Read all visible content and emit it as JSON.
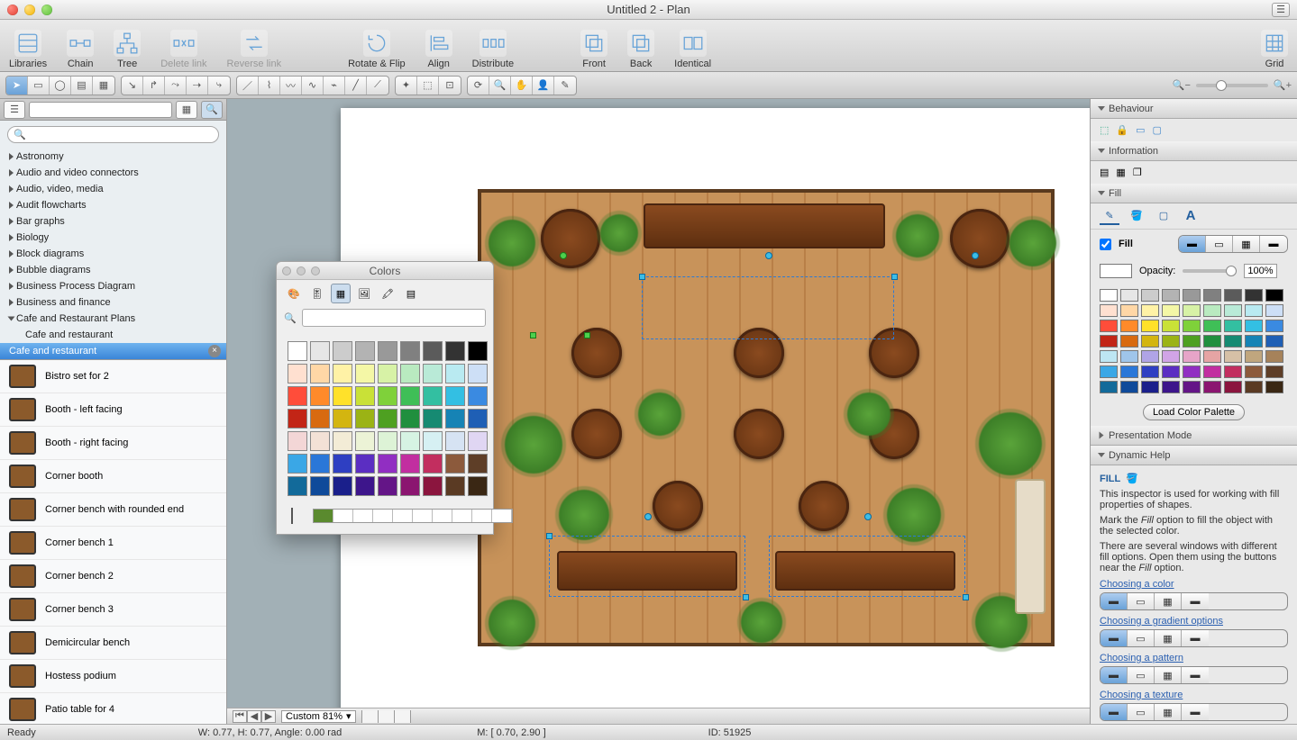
{
  "window": {
    "title": "Untitled 2 - Plan"
  },
  "toolbar": [
    {
      "id": "libraries",
      "label": "Libraries"
    },
    {
      "id": "chain",
      "label": "Chain"
    },
    {
      "id": "tree",
      "label": "Tree"
    },
    {
      "id": "delete-link",
      "label": "Delete link"
    },
    {
      "id": "reverse-link",
      "label": "Reverse link"
    },
    {
      "id": "rotate-flip",
      "label": "Rotate & Flip"
    },
    {
      "id": "align",
      "label": "Align"
    },
    {
      "id": "distribute",
      "label": "Distribute"
    },
    {
      "id": "front",
      "label": "Front"
    },
    {
      "id": "back",
      "label": "Back"
    },
    {
      "id": "identical",
      "label": "Identical"
    },
    {
      "id": "grid",
      "label": "Grid"
    }
  ],
  "sidebar": {
    "search_placeholder": "",
    "categories": [
      "Astronomy",
      "Audio and video connectors",
      "Audio, video, media",
      "Audit flowcharts",
      "Bar graphs",
      "Biology",
      "Block diagrams",
      "Bubble diagrams",
      "Business Process Diagram",
      "Business and finance",
      "Cafe and Restaurant Plans"
    ],
    "open_child": "Cafe and restaurant",
    "selected": "Cafe and restaurant",
    "shapes": [
      "Bistro set for 2",
      "Booth - left facing",
      "Booth - right facing",
      "Corner booth",
      "Corner bench with rounded end",
      "Corner bench 1",
      "Corner bench 2",
      "Corner bench 3",
      "Demicircular bench",
      "Hostess podium",
      "Patio table for 4"
    ]
  },
  "colors_popup": {
    "title": "Colors",
    "grid": [
      "#ffffff",
      "#e6e6e6",
      "#cccccc",
      "#b3b3b3",
      "#999999",
      "#808080",
      "#5b5b5b",
      "#333333",
      "#000000",
      "#ffe0d0",
      "#ffd7a6",
      "#fff2a6",
      "#f4f7a6",
      "#d7f2a6",
      "#b9eac0",
      "#b9ead7",
      "#b9eaf1",
      "#cddff6",
      "#ff4d3a",
      "#ff8a2a",
      "#ffe12a",
      "#c9e137",
      "#7fd13a",
      "#3fbf57",
      "#33bfa1",
      "#33bfe3",
      "#3a8ae1",
      "#c22516",
      "#d86a10",
      "#d3b510",
      "#9bb315",
      "#4ea021",
      "#208f3e",
      "#168a72",
      "#1683b5",
      "#1f5fb5",
      "#f3d6d6",
      "#f3e1d6",
      "#f3ecd6",
      "#ecf3d6",
      "#ddf3d6",
      "#d6f3e3",
      "#d6f0f3",
      "#d6e3f3",
      "#e0d6f3",
      "#3aa7e6",
      "#2a77d8",
      "#2e3fc2",
      "#5b2ec2",
      "#912ec2",
      "#c22ea0",
      "#c22e5f",
      "#8c5a3c",
      "#5e3e27",
      "#126a9a",
      "#0f4a9a",
      "#1a1f8b",
      "#3d158b",
      "#641587",
      "#8b1570",
      "#8b153e",
      "#5a3a23",
      "#3a2714"
    ],
    "recent": [
      "#5a8a2e",
      "#ffffff",
      "#ffffff",
      "#ffffff",
      "#ffffff",
      "#ffffff",
      "#ffffff",
      "#ffffff",
      "#ffffff",
      "#ffffff"
    ]
  },
  "inspector": {
    "sections": [
      "Behaviour",
      "Information",
      "Fill",
      "Presentation Mode",
      "Dynamic Help"
    ],
    "fill": {
      "checkbox_label": "Fill",
      "opacity_label": "Opacity:",
      "opacity_value": "100%",
      "load_btn": "Load Color Palette",
      "palette": [
        "#ffffff",
        "#e6e6e6",
        "#cccccc",
        "#b3b3b3",
        "#999999",
        "#808080",
        "#5b5b5b",
        "#333333",
        "#000000",
        "#ffe0d0",
        "#ffd7a6",
        "#fff2a6",
        "#f4f7a6",
        "#d7f2a6",
        "#b9eac0",
        "#b9ead7",
        "#b9eaf1",
        "#cddff6",
        "#ff4d3a",
        "#ff8a2a",
        "#ffe12a",
        "#c9e137",
        "#7fd13a",
        "#3fbf57",
        "#33bfa1",
        "#33bfe3",
        "#3a8ae1",
        "#c22516",
        "#d86a10",
        "#d3b510",
        "#9bb315",
        "#4ea021",
        "#208f3e",
        "#168a72",
        "#1683b5",
        "#1f5fb5",
        "#bde6f3",
        "#9fc5ea",
        "#b0a4e6",
        "#d1a4e6",
        "#e6a4c8",
        "#e6a4a4",
        "#d6c0a6",
        "#c0a67e",
        "#a6825a",
        "#3aa7e6",
        "#2a77d8",
        "#2e3fc2",
        "#5b2ec2",
        "#912ec2",
        "#c22ea0",
        "#c22e5f",
        "#8c5a3c",
        "#5e3e27",
        "#126a9a",
        "#0f4a9a",
        "#1a1f8b",
        "#3d158b",
        "#641587",
        "#8b1570",
        "#8b153e",
        "#5a3a23",
        "#3a2714"
      ]
    },
    "help": {
      "title": "FILL",
      "p1": "This inspector is used for working with fill properties of shapes.",
      "p2a": "Mark the ",
      "p2i": "Fill",
      "p2b": " option to fill the object with the selected color.",
      "p3a": "There are several windows with different fill options. Open them using the buttons near the ",
      "p3i": "Fill",
      "p3b": " option.",
      "links": [
        "Choosing a color",
        "Choosing a gradient options",
        "Choosing a pattern",
        "Choosing a texture"
      ]
    }
  },
  "canvas_bar": {
    "zoom": "Custom 81%"
  },
  "status": {
    "ready": "Ready",
    "dims": "W: 0.77,  H: 0.77,  Angle: 0.00 rad",
    "mouse": "M: [ 0.70, 2.90 ]",
    "id": "ID: 51925"
  }
}
